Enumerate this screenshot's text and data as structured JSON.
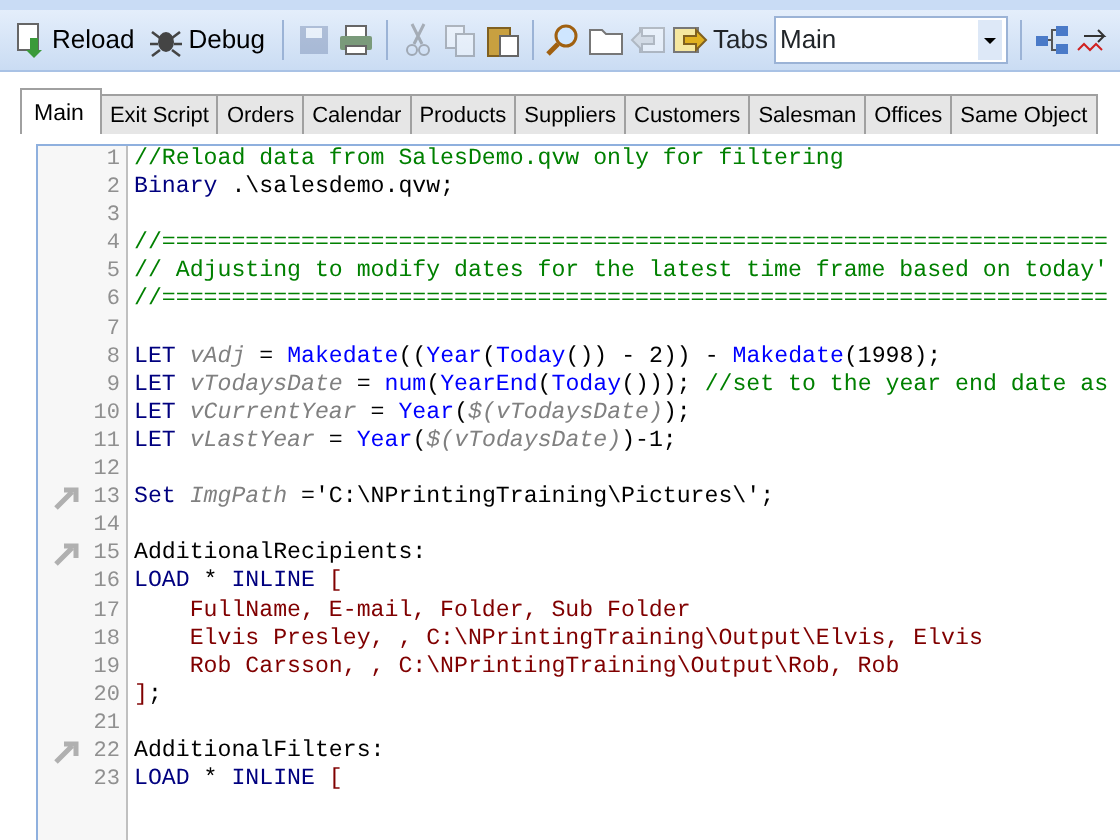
{
  "toolbar": {
    "items": [
      {
        "kind": "button",
        "label": "Reload",
        "disabled": false
      },
      {
        "kind": "button",
        "label": "Debug",
        "disabled": false
      },
      {
        "kind": "sep"
      },
      {
        "kind": "icon",
        "disabled": true
      },
      {
        "kind": "icon",
        "disabled": false
      },
      {
        "kind": "sep"
      },
      {
        "kind": "icon",
        "disabled": true
      },
      {
        "kind": "icon",
        "disabled": true
      },
      {
        "kind": "icon",
        "disabled": false
      },
      {
        "kind": "sep"
      },
      {
        "kind": "icon",
        "disabled": false
      },
      {
        "kind": "icon",
        "disabled": false
      },
      {
        "kind": "icon",
        "disabled": true
      },
      {
        "kind": "icon",
        "disabled": false
      }
    ],
    "tabs_label": "Tabs",
    "tabs_select": {
      "value": "Main"
    }
  },
  "tabs": [
    {
      "label": "Main",
      "selected": true
    },
    {
      "label": "Exit Script",
      "selected": false
    },
    {
      "label": "Orders",
      "selected": false
    },
    {
      "label": "Calendar",
      "selected": false
    },
    {
      "label": "Products",
      "selected": false
    },
    {
      "label": "Suppliers",
      "selected": false
    },
    {
      "label": "Customers",
      "selected": false
    },
    {
      "label": "Salesman",
      "selected": false
    },
    {
      "label": "Offices",
      "selected": false
    },
    {
      "label": "Same Object",
      "selected": false
    }
  ],
  "editor": {
    "lines": [
      {
        "number": "1",
        "bookmark": false,
        "tokens": [
          {
            "kind": "cmt",
            "text": "//Reload data from SalesDemo.qvw only for filtering"
          }
        ]
      },
      {
        "number": "2",
        "bookmark": false,
        "tokens": [
          {
            "kind": "kw",
            "text": "Binary"
          },
          {
            "kind": "plain",
            "text": " .\\salesdemo.qvw;"
          }
        ]
      },
      {
        "number": "3",
        "bookmark": false
      },
      {
        "number": "4",
        "bookmark": false,
        "tokens": [
          {
            "kind": "cmt",
            "text": "//===================================================================="
          }
        ]
      },
      {
        "number": "5",
        "bookmark": false,
        "tokens": [
          {
            "kind": "cmt",
            "text": "// Adjusting to modify dates for the latest time frame based on today'"
          }
        ]
      },
      {
        "number": "6",
        "bookmark": false,
        "tokens": [
          {
            "kind": "cmt",
            "text": "//===================================================================="
          }
        ]
      },
      {
        "number": "7",
        "bookmark": false
      },
      {
        "number": "8",
        "bookmark": false,
        "tokens": [
          {
            "kind": "kw",
            "text": "LET "
          },
          {
            "kind": "var",
            "text": "vAdj"
          },
          {
            "kind": "plain",
            "text": " = "
          },
          {
            "kind": "fn",
            "text": "Makedate"
          },
          {
            "kind": "plain",
            "text": "(("
          },
          {
            "kind": "fn",
            "text": "Year"
          },
          {
            "kind": "plain",
            "text": "("
          },
          {
            "kind": "fn",
            "text": "Today"
          },
          {
            "kind": "plain",
            "text": "()) - 2)) - "
          },
          {
            "kind": "fn",
            "text": "Makedate"
          },
          {
            "kind": "plain",
            "text": "(1998);"
          }
        ]
      },
      {
        "number": "9",
        "bookmark": false,
        "tokens": [
          {
            "kind": "kw",
            "text": "LET "
          },
          {
            "kind": "var",
            "text": "vTodaysDate"
          },
          {
            "kind": "plain",
            "text": " = "
          },
          {
            "kind": "fn",
            "text": "num"
          },
          {
            "kind": "plain",
            "text": "("
          },
          {
            "kind": "fn",
            "text": "YearEnd"
          },
          {
            "kind": "plain",
            "text": "("
          },
          {
            "kind": "fn",
            "text": "Today"
          },
          {
            "kind": "plain",
            "text": "())); "
          },
          {
            "kind": "cmt",
            "text": "//set to the year end date as"
          }
        ]
      },
      {
        "number": "10",
        "bookmark": false,
        "tokens": [
          {
            "kind": "kw",
            "text": "LET "
          },
          {
            "kind": "var",
            "text": "vCurrentYear"
          },
          {
            "kind": "plain",
            "text": " = "
          },
          {
            "kind": "fn",
            "text": "Year"
          },
          {
            "kind": "plain",
            "text": "("
          },
          {
            "kind": "var",
            "text": "$(vTodaysDate)"
          },
          {
            "kind": "plain",
            "text": ");"
          }
        ]
      },
      {
        "number": "11",
        "bookmark": false,
        "tokens": [
          {
            "kind": "kw",
            "text": "LET "
          },
          {
            "kind": "var",
            "text": "vLastYear"
          },
          {
            "kind": "plain",
            "text": " = "
          },
          {
            "kind": "fn",
            "text": "Year"
          },
          {
            "kind": "plain",
            "text": "("
          },
          {
            "kind": "var",
            "text": "$(vTodaysDate)"
          },
          {
            "kind": "plain",
            "text": ")-1;"
          }
        ]
      },
      {
        "number": "12",
        "bookmark": false
      },
      {
        "number": "13",
        "bookmark": true,
        "tokens": [
          {
            "kind": "kw",
            "text": "Set "
          },
          {
            "kind": "var",
            "text": "ImgPath"
          },
          {
            "kind": "plain",
            "text": " ='C:\\NPrintingTraining\\Pictures\\';"
          }
        ]
      },
      {
        "number": "14",
        "bookmark": false
      },
      {
        "number": "15",
        "bookmark": true,
        "tokens": [
          {
            "kind": "plain",
            "text": "AdditionalRecipients:"
          }
        ]
      },
      {
        "number": "16",
        "bookmark": false,
        "tokens": [
          {
            "kind": "kw",
            "text": "LOAD"
          },
          {
            "kind": "plain",
            "text": " * "
          },
          {
            "kind": "kw",
            "text": "INLINE "
          },
          {
            "kind": "str",
            "text": "["
          }
        ]
      },
      {
        "number": "17",
        "bookmark": false,
        "tokens": [
          {
            "kind": "str",
            "text": "    FullName, E-mail, Folder, Sub Folder"
          }
        ]
      },
      {
        "number": "18",
        "bookmark": false,
        "tokens": [
          {
            "kind": "str",
            "text": "    Elvis Presley, , C:\\NPrintingTraining\\Output\\Elvis, Elvis"
          }
        ]
      },
      {
        "number": "19",
        "bookmark": false,
        "tokens": [
          {
            "kind": "str",
            "text": "    Rob Carsson, , C:\\NPrintingTraining\\Output\\Rob, Rob"
          }
        ]
      },
      {
        "number": "20",
        "bookmark": false,
        "tokens": [
          {
            "kind": "str",
            "text": "]"
          },
          {
            "kind": "plain",
            "text": ";"
          }
        ]
      },
      {
        "number": "21",
        "bookmark": false
      },
      {
        "number": "22",
        "bookmark": true,
        "tokens": [
          {
            "kind": "plain",
            "text": "AdditionalFilters:"
          }
        ]
      },
      {
        "number": "23",
        "bookmark": false,
        "tokens": [
          {
            "kind": "kw",
            "text": "LOAD"
          },
          {
            "kind": "plain",
            "text": " * "
          },
          {
            "kind": "kw",
            "text": "INLINE "
          },
          {
            "kind": "str",
            "text": "["
          }
        ]
      }
    ]
  }
}
